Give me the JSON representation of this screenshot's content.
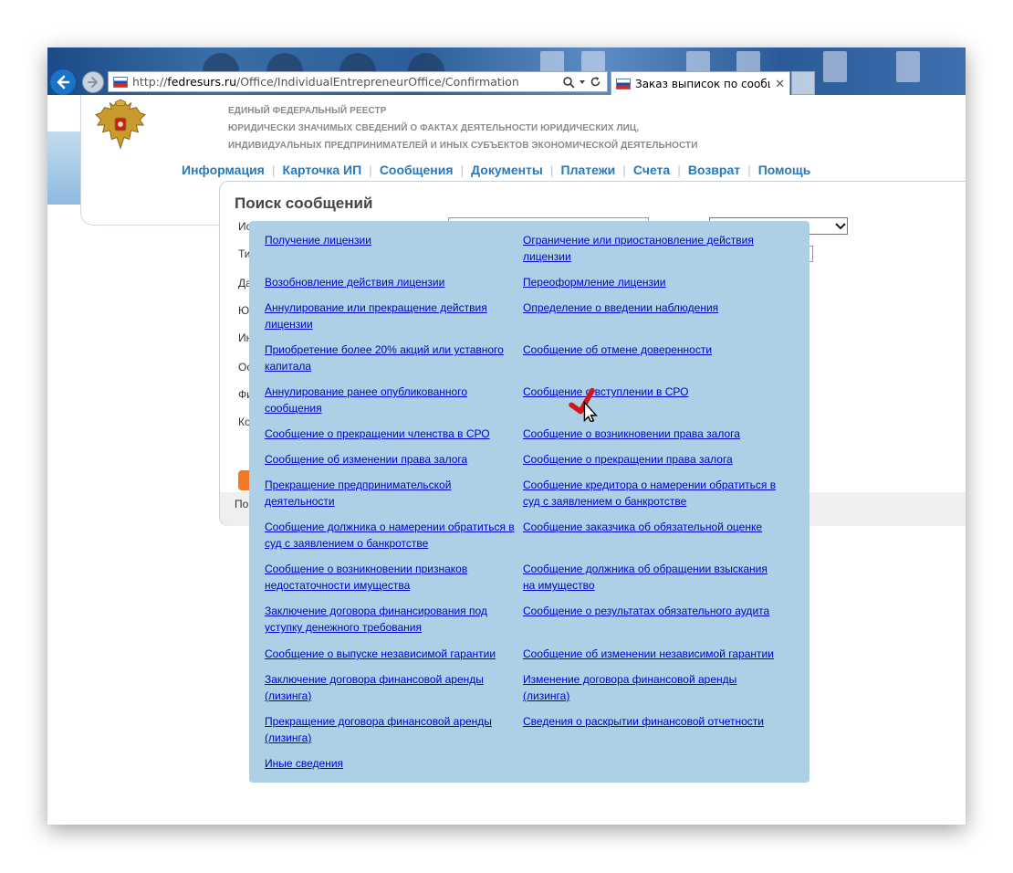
{
  "browser": {
    "url_host": "fedresurs.ru",
    "url_prefix": "http://",
    "url_path": "/Office/IndividualEntrepreneurOffice/Confirmation",
    "tab_title": "Заказ выписок по сообще...",
    "search_icon": "search-icon",
    "refresh_icon": "refresh-icon"
  },
  "header": {
    "line1": "ЕДИНЫЙ ФЕДЕРАЛЬНЫЙ РЕЕСТР",
    "line2": "ЮРИДИЧЕСКИ ЗНАЧИМЫХ СВЕДЕНИЙ О ФАКТАХ ДЕЯТЕЛЬНОСТИ ЮРИДИЧЕСКИХ ЛИЦ,",
    "line3": "ИНДИВИДУАЛЬНЫХ ПРЕДПРИНИМАТЕЛЕЙ И ИНЫХ СУБЪЕКТОВ ЭКОНОМИЧЕСКОЙ ДЕЯТЕЛЬНОСТИ",
    "nav": [
      "Информация",
      "Карточка ИП",
      "Сообщения",
      "Документы",
      "Платежи",
      "Счета",
      "Возврат",
      "Помощь"
    ]
  },
  "search": {
    "title": "Поиск сообщений",
    "label_fragments": [
      "Ис",
      "Ти",
      "Да",
      "Ю",
      "Ин",
      "Ос",
      "Фи",
      "Ко"
    ],
    "status_fragment": "По"
  },
  "dropdown": {
    "left": [
      "Получение лицензии",
      "Возобновление действия лицензии",
      "Аннулирование или прекращение действия лицензии",
      "Приобретение более 20% акций или уставного капитала",
      "Аннулирование ранее опубликованного сообщения",
      "Сообщение о прекращении членства в СРО",
      "Сообщение об изменении права залога",
      "Прекращение предпринимательской деятельности",
      "Сообщение должника о намерении обратиться в суд с заявлением о банкротстве",
      "Сообщение о возникновении признаков недостаточности имущества",
      "Заключение договора финансирования под уступку денежного требования",
      "Сообщение о выпуске независимой гарантии",
      "Заключение договора финансовой аренды (лизинга)",
      "Прекращение договора финансовой аренды (лизинга)",
      "Иные сведения"
    ],
    "right": [
      "Ограничение или приостановление действия лицензии",
      "Переоформление лицензии",
      "Определение о введении наблюдения",
      "Сообщение об отмене доверенности",
      "Сообщение о вступлении в СРО",
      "Сообщение о возникновении права залога",
      "Сообщение о прекращении права залога",
      "Сообщение кредитора о намерении обратиться в суд с заявлением о банкротстве",
      "Сообщение заказчика об обязательной оценке",
      "Сообщение должника об обращении взыскания на имущество",
      "Сообщение о результатах обязательного аудита",
      "Сообщение об изменении независимой гарантии",
      "Изменение договора финансовой аренды (лизинга)",
      "Сведения о раскрытии финансовой отчетности"
    ]
  },
  "colors": {
    "link": "#0000cc",
    "panel": "#aed0e7",
    "nav": "#2b78b8",
    "check_mark": "#d0181c"
  }
}
